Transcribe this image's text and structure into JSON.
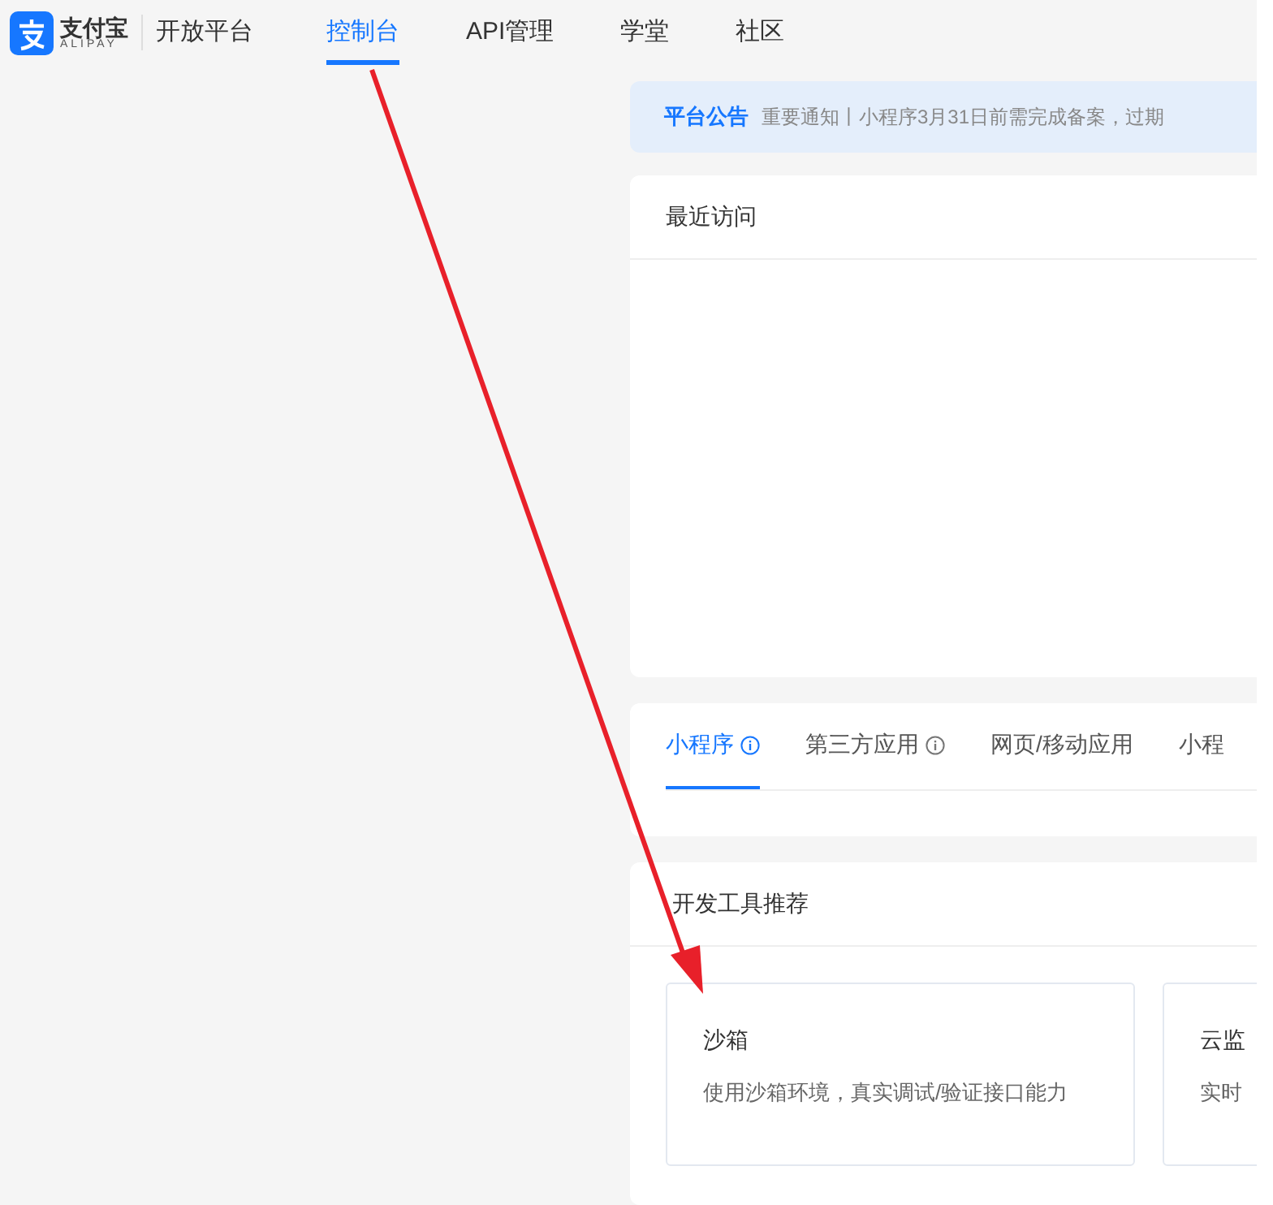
{
  "header": {
    "logo": {
      "name": "支付宝",
      "sub": "ALIPAY"
    },
    "platform": "开放平台",
    "nav": [
      {
        "label": "控制台",
        "selected": true
      },
      {
        "label": "API管理",
        "selected": false
      },
      {
        "label": "学堂",
        "selected": false
      },
      {
        "label": "社区",
        "selected": false
      }
    ]
  },
  "announcement": {
    "label": "平台公告",
    "text": "重要通知丨小程序3月31日前需完成备案，过期"
  },
  "recent": {
    "title": "最近访问"
  },
  "app_tabs": [
    {
      "label": "小程序",
      "info": true,
      "selected": true
    },
    {
      "label": "第三方应用",
      "info": true,
      "selected": false
    },
    {
      "label": "网页/移动应用",
      "info": false,
      "selected": false
    },
    {
      "label": "小程",
      "info": false,
      "selected": false
    }
  ],
  "dev_tools": {
    "title": "开发工具推荐",
    "cards": [
      {
        "title": "沙箱",
        "description": "使用沙箱环境，真实调试/验证接口能力"
      },
      {
        "title": "云监",
        "description": "实时"
      }
    ]
  }
}
